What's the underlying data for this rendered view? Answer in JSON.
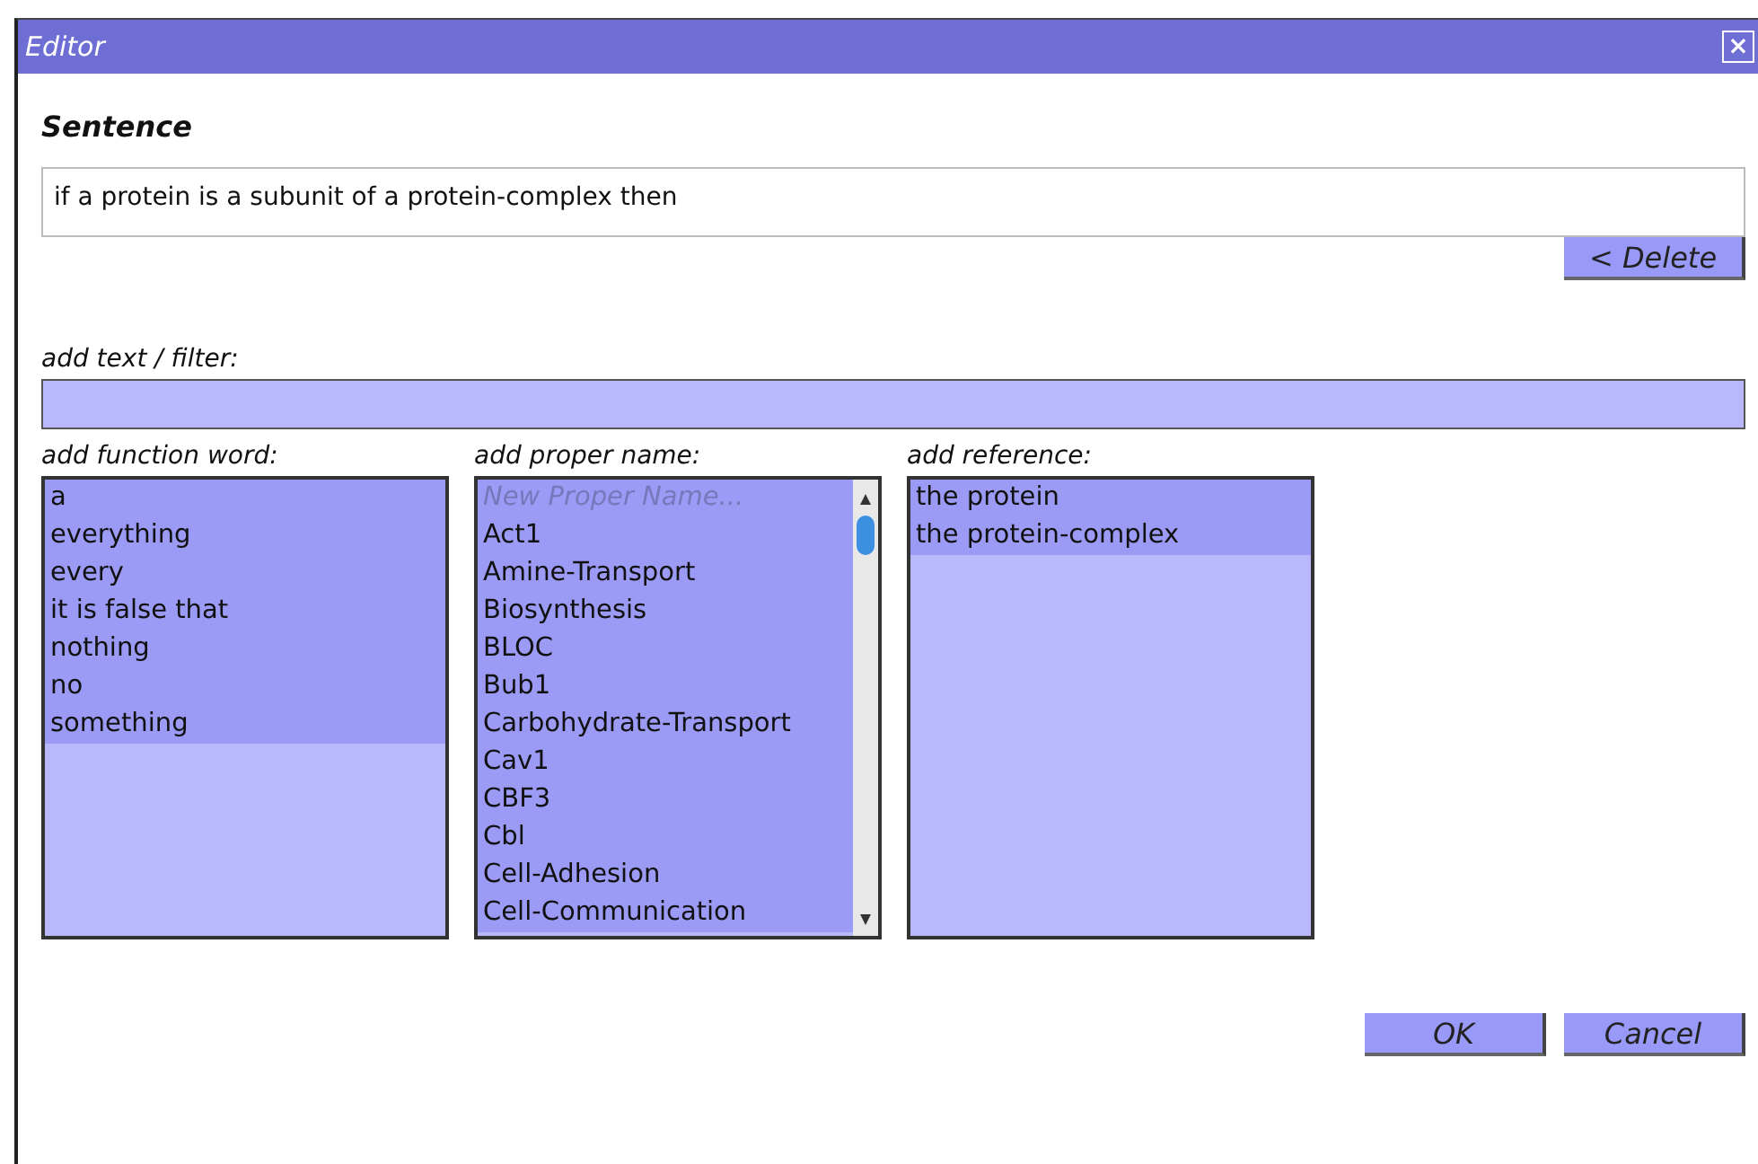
{
  "window": {
    "title": "Editor",
    "close": "×"
  },
  "sentence": {
    "heading": "Sentence",
    "text": "if a protein is a subunit of a protein-complex then",
    "delete_button": "< Delete"
  },
  "filter": {
    "label": "add text / filter:"
  },
  "lists": [
    {
      "kind": "plain",
      "label": "add function word:",
      "items": [
        "a",
        "everything",
        "every",
        "it is false that",
        "nothing",
        "no",
        "something"
      ]
    },
    {
      "kind": "scrolling",
      "label": "add proper name:",
      "placeholder": "New Proper Name...",
      "items": [
        "Act1",
        "Amine-Transport",
        "Biosynthesis",
        "BLOC",
        "Bub1",
        "Carbohydrate-Transport",
        "Cav1",
        "CBF3",
        "Cbl",
        "Cell-Adhesion",
        "Cell-Communication"
      ]
    },
    {
      "kind": "plain",
      "label": "add reference:",
      "items": [
        "the protein",
        "the protein-complex"
      ]
    }
  ],
  "buttons": [
    "OK",
    "Cancel"
  ]
}
